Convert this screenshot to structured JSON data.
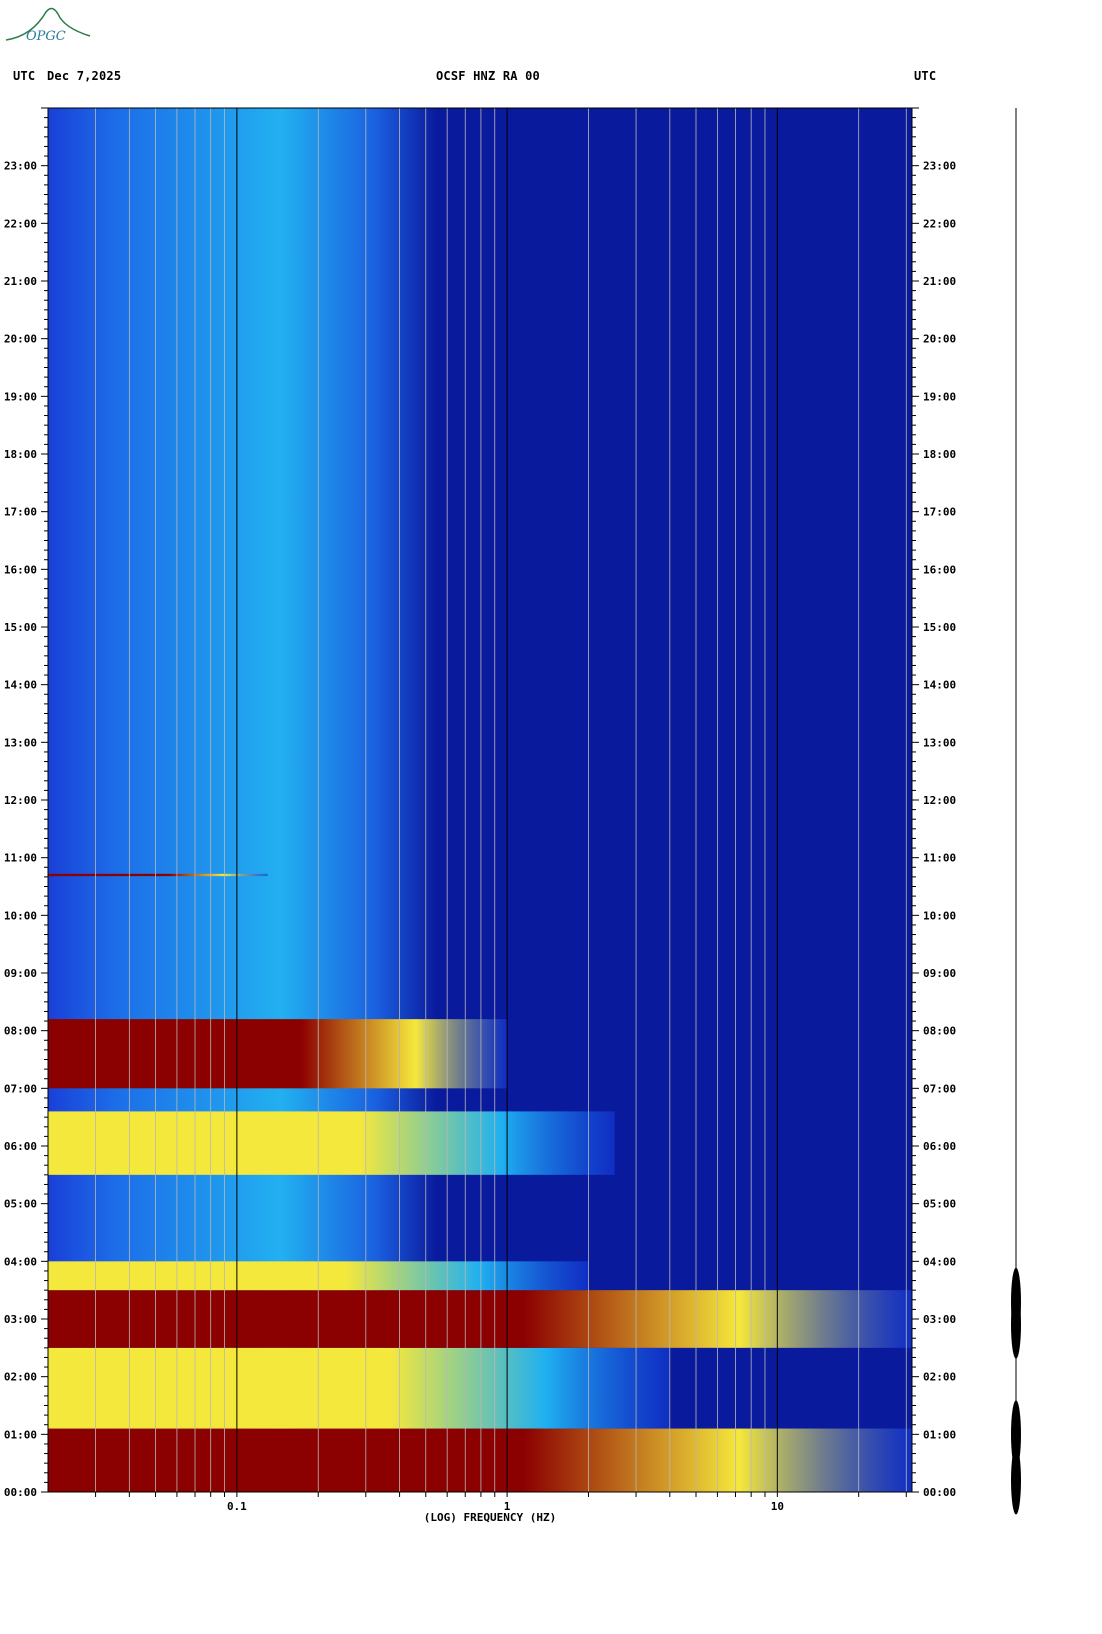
{
  "header": {
    "left_tz": "UTC",
    "date": "Dec 7,2025",
    "station": "OCSF HNZ RA 00",
    "right_tz": "UTC"
  },
  "logo": {
    "text": "OPGC",
    "color": "#2a7a4a"
  },
  "colors": {
    "low": "#0a1a9c",
    "mid": "#1fb0f0",
    "high": "#f5e83c",
    "peak": "#8b0000"
  },
  "chart_data": {
    "type": "heatmap",
    "title": "OCSF HNZ RA 00",
    "xlabel": "(LOG) FREQUENCY (HZ)",
    "ylabel": "",
    "x_scale": "log",
    "xlim": [
      0.02,
      31.5
    ],
    "x_ticks": [
      0.1,
      1,
      10
    ],
    "x_tick_labels": [
      "0.1",
      "1",
      "10"
    ],
    "ylim_hours_utc": [
      0,
      24
    ],
    "y_tick_labels": [
      "00:00",
      "01:00",
      "02:00",
      "03:00",
      "04:00",
      "05:00",
      "06:00",
      "07:00",
      "08:00",
      "09:00",
      "10:00",
      "11:00",
      "12:00",
      "13:00",
      "14:00",
      "15:00",
      "16:00",
      "17:00",
      "18:00",
      "19:00",
      "20:00",
      "21:00",
      "22:00",
      "23:00"
    ],
    "grid_frequencies_hz": [
      0.03,
      0.04,
      0.05,
      0.06,
      0.07,
      0.08,
      0.09,
      0.1,
      0.2,
      0.3,
      0.4,
      0.5,
      0.6,
      0.7,
      0.8,
      0.9,
      1,
      2,
      3,
      4,
      5,
      6,
      7,
      8,
      9,
      10,
      20,
      30
    ],
    "bands": [
      {
        "start_h": 0.0,
        "end_h": 1.1,
        "fmax_hz": 31.5,
        "level": "peak"
      },
      {
        "start_h": 1.1,
        "end_h": 2.5,
        "fmax_hz": 4.0,
        "level": "high"
      },
      {
        "start_h": 2.5,
        "end_h": 3.5,
        "fmax_hz": 31.5,
        "level": "peak"
      },
      {
        "start_h": 3.5,
        "end_h": 4.0,
        "fmax_hz": 2.0,
        "level": "high"
      },
      {
        "start_h": 5.5,
        "end_h": 6.6,
        "fmax_hz": 2.5,
        "level": "high"
      },
      {
        "start_h": 7.0,
        "end_h": 8.2,
        "fmax_hz": 1.0,
        "level": "peak"
      },
      {
        "start_h": 10.68,
        "end_h": 10.72,
        "fmax_hz": 0.13,
        "level": "peak"
      }
    ],
    "trace_events_hours_utc": [
      0.2,
      1.0,
      2.9,
      3.3
    ]
  }
}
